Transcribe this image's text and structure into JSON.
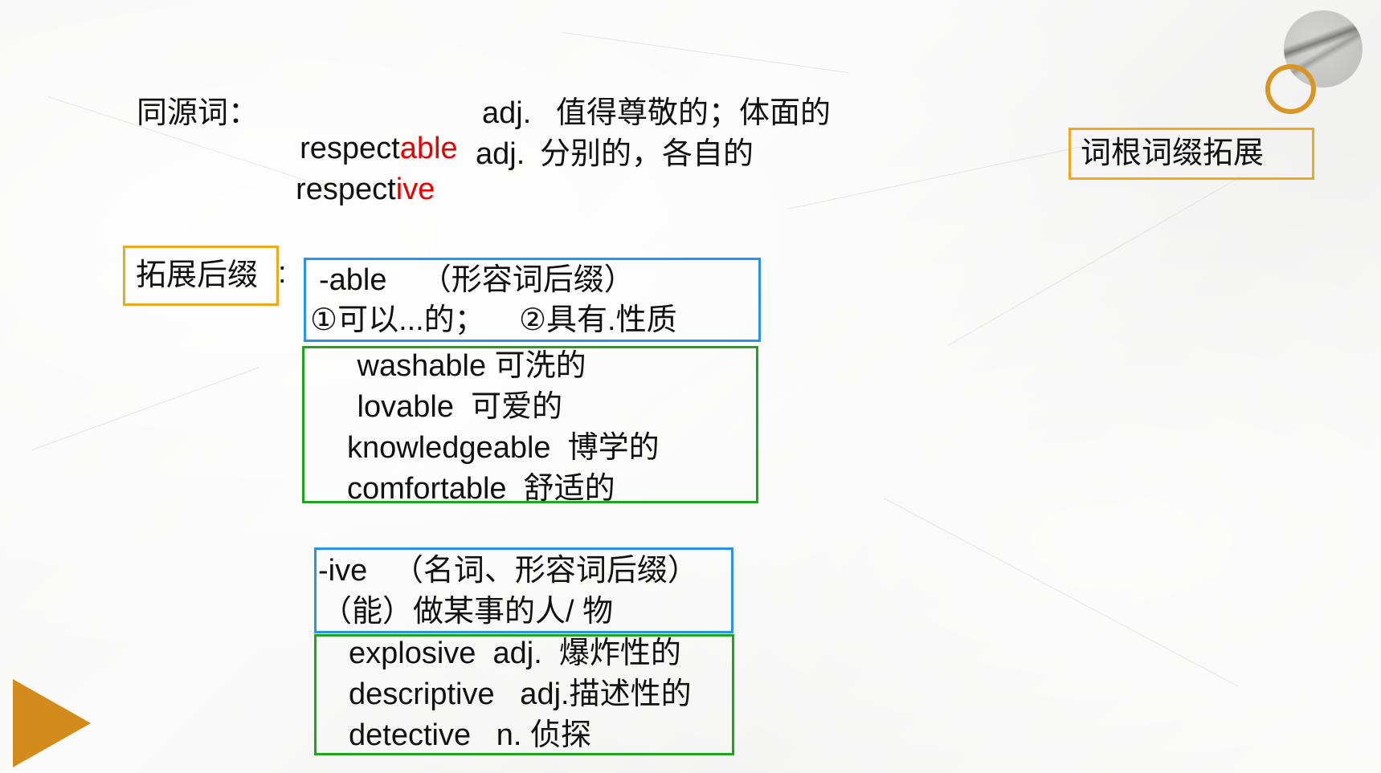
{
  "slide": {
    "badge_title": "词根词缀拓展",
    "cognates": {
      "label": "同源词：",
      "items": [
        {
          "stem": "respect",
          "suffix": "able",
          "pos": "adj.",
          "meaning": "值得尊敬的；体面的"
        },
        {
          "stem": "respect",
          "suffix": "ive",
          "pos": "adj.",
          "meaning": "分别的，各自的"
        }
      ]
    },
    "extend_label": "拓展后缀",
    "extend_colon": ":",
    "suffix_groups": [
      {
        "suffix_line": "-able    （形容词后缀）",
        "meaning_line": "①可以...的；    ②具有.性质",
        "examples": [
          " washable 可洗的",
          " lovable  可爱的",
          "knowledgeable  博学的",
          "comfortable  舒适的"
        ]
      },
      {
        "suffix_line": "-ive   （名词、形容词后缀）",
        "meaning_line": "（能）做某事的人/ 物",
        "examples": [
          "explosive  adj.  爆炸性的",
          "descriptive   adj.描述性的",
          "detective   n. 侦探"
        ]
      }
    ],
    "colors": {
      "orange_border": "#f0a81e",
      "blue_border": "#2a93e8",
      "green_border": "#1ea51e",
      "highlight_red": "#e60000",
      "gold": "#d38c1c"
    },
    "decorations": [
      "marble-circle",
      "gold-ring",
      "play-triangle"
    ]
  }
}
